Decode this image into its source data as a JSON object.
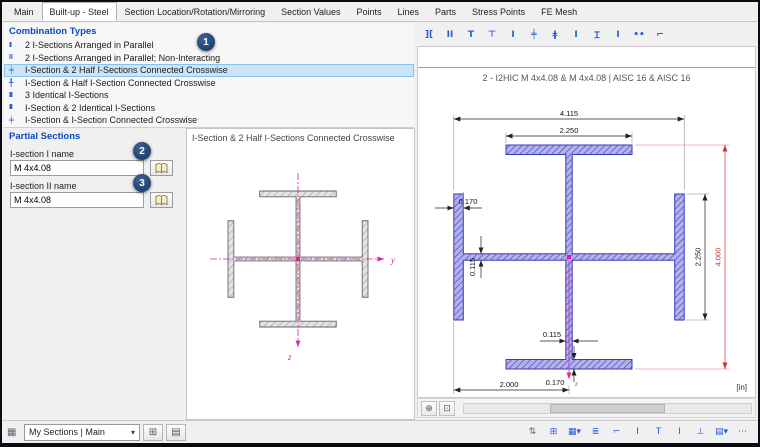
{
  "tabs": {
    "items": [
      {
        "name": "tab-main",
        "label": "Main"
      },
      {
        "name": "tab-built-up-steel",
        "label": "Built-up - Steel"
      },
      {
        "name": "tab-section-location",
        "label": "Section Location/Rotation/Mirroring"
      },
      {
        "name": "tab-section-values",
        "label": "Section Values"
      },
      {
        "name": "tab-points",
        "label": "Points"
      },
      {
        "name": "tab-lines",
        "label": "Lines"
      },
      {
        "name": "tab-parts",
        "label": "Parts"
      },
      {
        "name": "tab-stress-points",
        "label": "Stress Points"
      },
      {
        "name": "tab-fe-mesh",
        "label": "FE Mesh"
      }
    ],
    "selected": "Built-up - Steel"
  },
  "combination_types": {
    "header": "Combination Types",
    "selected_index": 2,
    "items": [
      {
        "name": "combo-2-i-parallel",
        "icon": "two-i-sections-icon",
        "glyph": "ΙΙ",
        "label": "2 I-Sections Arranged in Parallel"
      },
      {
        "name": "combo-2-i-parallel-noninteracting",
        "icon": "two-i-sections-gap-icon",
        "glyph": "Ι Ι",
        "label": "2 I-Sections Arranged in Parallel; Non-Interacting"
      },
      {
        "name": "combo-i-2half-crosswise",
        "icon": "cross-section-icon",
        "glyph": "╪",
        "label": "I-Section & 2 Half I-Sections Connected Crosswise"
      },
      {
        "name": "combo-i-half-crosswise",
        "icon": "half-cross-section-icon",
        "glyph": "╀",
        "label": "I-Section & Half I-Section Connected Crosswise"
      },
      {
        "name": "combo-3-identical-i",
        "icon": "three-i-sections-icon",
        "glyph": "ΙΙΙ",
        "label": "3 Identical I-Sections"
      },
      {
        "name": "combo-i-2-identical-i",
        "icon": "three-i-mixed-icon",
        "glyph": "ΙΙΙ",
        "label": "I-Section & 2 Identical I-Sections"
      },
      {
        "name": "combo-i-i-crosswise",
        "icon": "i-cross-icon",
        "glyph": "╪",
        "label": "I-Section & I-Section Connected Crosswise"
      }
    ]
  },
  "partial_sections": {
    "header": "Partial Sections",
    "fields": [
      {
        "label": "I-section I name",
        "value": "M 4x4.08"
      },
      {
        "label": "I-section II name",
        "value": "M 4x4.08"
      }
    ]
  },
  "preview": {
    "title": "I-Section & 2 Half I-Sections Connected Crosswise",
    "axis_y": "y",
    "axis_z": "z"
  },
  "section_toolbar": {
    "icons": [
      {
        "name": "type-two-channels-icon",
        "glyph": "]["
      },
      {
        "name": "type-two-i-parallel-icon",
        "glyph": "ΙΙ"
      },
      {
        "name": "type-tee-icon",
        "glyph": "Τ"
      },
      {
        "name": "type-tee-top-icon",
        "glyph": "⊤"
      },
      {
        "name": "type-i-icon",
        "glyph": "Ι"
      },
      {
        "name": "type-cross-icon",
        "glyph": "╪"
      },
      {
        "name": "type-i-stiffened-icon",
        "glyph": "ǂ"
      },
      {
        "name": "type-i-plain-icon",
        "glyph": "I"
      },
      {
        "name": "type-i-plate-icon",
        "glyph": "Ɪ"
      },
      {
        "name": "type-i-narrow-icon",
        "glyph": "Ι"
      },
      {
        "name": "type-two-dots-icon",
        "glyph": "••"
      },
      {
        "name": "type-channel-icon",
        "glyph": "⌐"
      }
    ]
  },
  "drawing": {
    "title": "2 - I2HIC M 4x4.08 & M 4x4.08 | AISC 16 & AISC 16",
    "unit": "[in]",
    "axis_z": "z",
    "dims": {
      "overall_width": "4.115",
      "top_flange_width": "2.250",
      "left_flange_thickness": "0.170",
      "left_web_thickness": "0.115",
      "right_flange_height": "2.250",
      "overall_height": "4.000",
      "bottom_web_thickness": "0.115",
      "bottom_flange_thickness": "0.170",
      "bottom_half_width": "2.000"
    }
  },
  "badges": [
    "1",
    "2",
    "3"
  ],
  "view_buttons": [
    {
      "name": "zoom-extents-icon",
      "glyph": "⊕"
    },
    {
      "name": "pan-icon",
      "glyph": "⊡"
    }
  ],
  "statusbar": {
    "left_icon": {
      "name": "sections-grid-icon",
      "glyph": "▦"
    },
    "sections_dropdown": "My Sections | Main",
    "caret_glyph": "▾",
    "left_buttons": [
      {
        "name": "new-favorite-icon",
        "glyph": "⊞"
      },
      {
        "name": "open-folder-icon",
        "glyph": "▤"
      }
    ],
    "right_icons": [
      {
        "name": "sort-icon",
        "glyph": "⇅"
      },
      {
        "name": "split-view-icon",
        "glyph": "⊞"
      },
      {
        "name": "render-mode-icon",
        "glyph": "▦▾"
      },
      {
        "name": "show-values-icon",
        "glyph": "≣"
      },
      {
        "name": "stress-points-icon",
        "glyph": "⌐"
      },
      {
        "name": "outline-icon",
        "glyph": "Ι"
      },
      {
        "name": "dimensions-icon",
        "glyph": "Τ"
      },
      {
        "name": "axes-icon",
        "glyph": "Ι"
      },
      {
        "name": "supports-icon",
        "glyph": "⊥"
      },
      {
        "name": "display-settings-icon",
        "glyph": "▤▾"
      },
      {
        "name": "more-options-icon",
        "glyph": "⋯"
      }
    ]
  },
  "colors": {
    "accent_blue": "#2a5bd7",
    "selection": "#cbe4f9",
    "section_fill_blue": "#b2b2ec",
    "section_line_blue": "#3a3ab8",
    "dim_red": "#d83030",
    "axis_magenta": "#dd22aa"
  }
}
